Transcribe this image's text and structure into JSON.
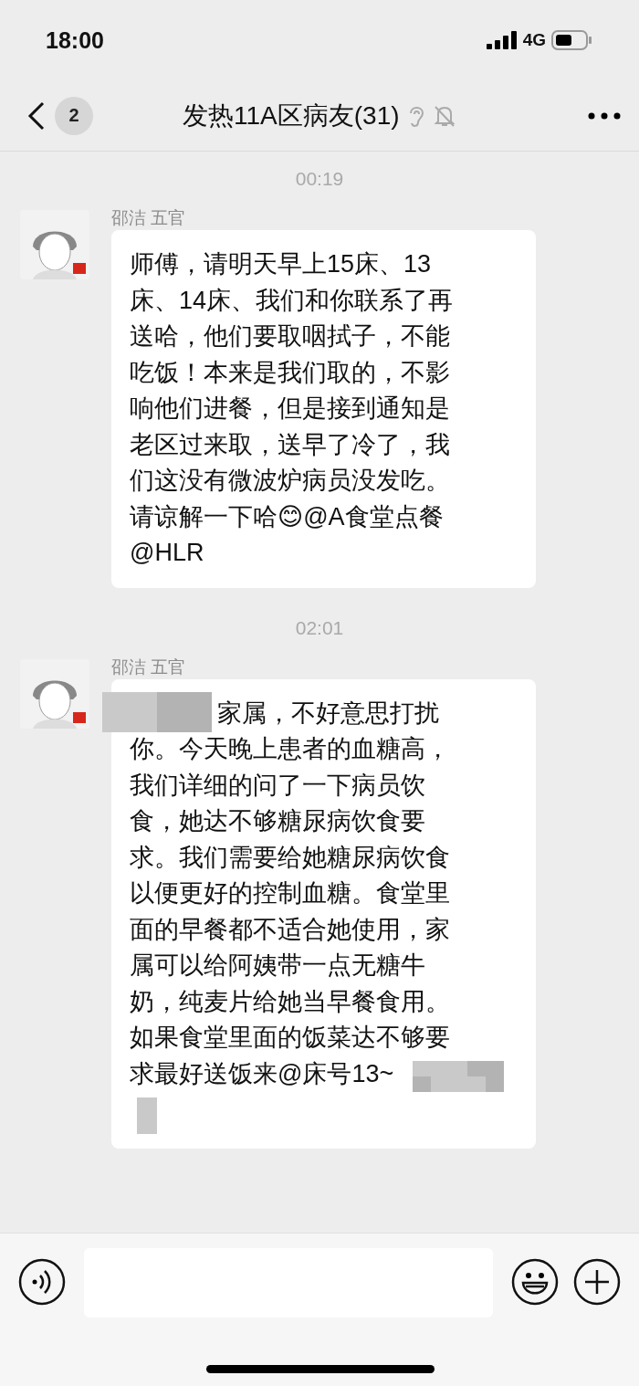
{
  "status_bar": {
    "time": "18:00",
    "network": "4G"
  },
  "nav_bar": {
    "unread_count": "2",
    "title": "发热11A区病友(31)",
    "earpiece_mode": true,
    "muted": true
  },
  "messages": [
    {
      "timestamp": "00:19",
      "sender": "邵洁 五官",
      "lines": [
        "师傅，请明天早上15床、13",
        "床、14床、我们和你联系了再",
        "送哈，他们要取咽拭子，不能",
        "吃饭！本来是我们取的，不影",
        "响他们进餐，但是接到通知是",
        "老区过来取，送早了冷了，我",
        "们这没有微波炉病员没发吃。",
        "请谅解一下哈😊@A食堂点餐",
        "@HLR"
      ]
    },
    {
      "timestamp": "02:01",
      "sender": "邵洁 五官",
      "redacted_start": true,
      "redacted_end": true,
      "lines": [
        "家属，不好意思打扰",
        "你。今天晚上患者的血糖高，",
        "我们详细的问了一下病员饮",
        "食，她达不够糖尿病饮食要",
        "求。我们需要给她糖尿病饮食",
        "以便更好的控制血糖。食堂里",
        "面的早餐都不适合她使用，家",
        "属可以给阿姨带一点无糖牛",
        "奶，纯麦片给她当早餐食用。",
        "如果食堂里面的饭菜达不够要",
        "求最好送饭来@床号13~"
      ]
    }
  ]
}
